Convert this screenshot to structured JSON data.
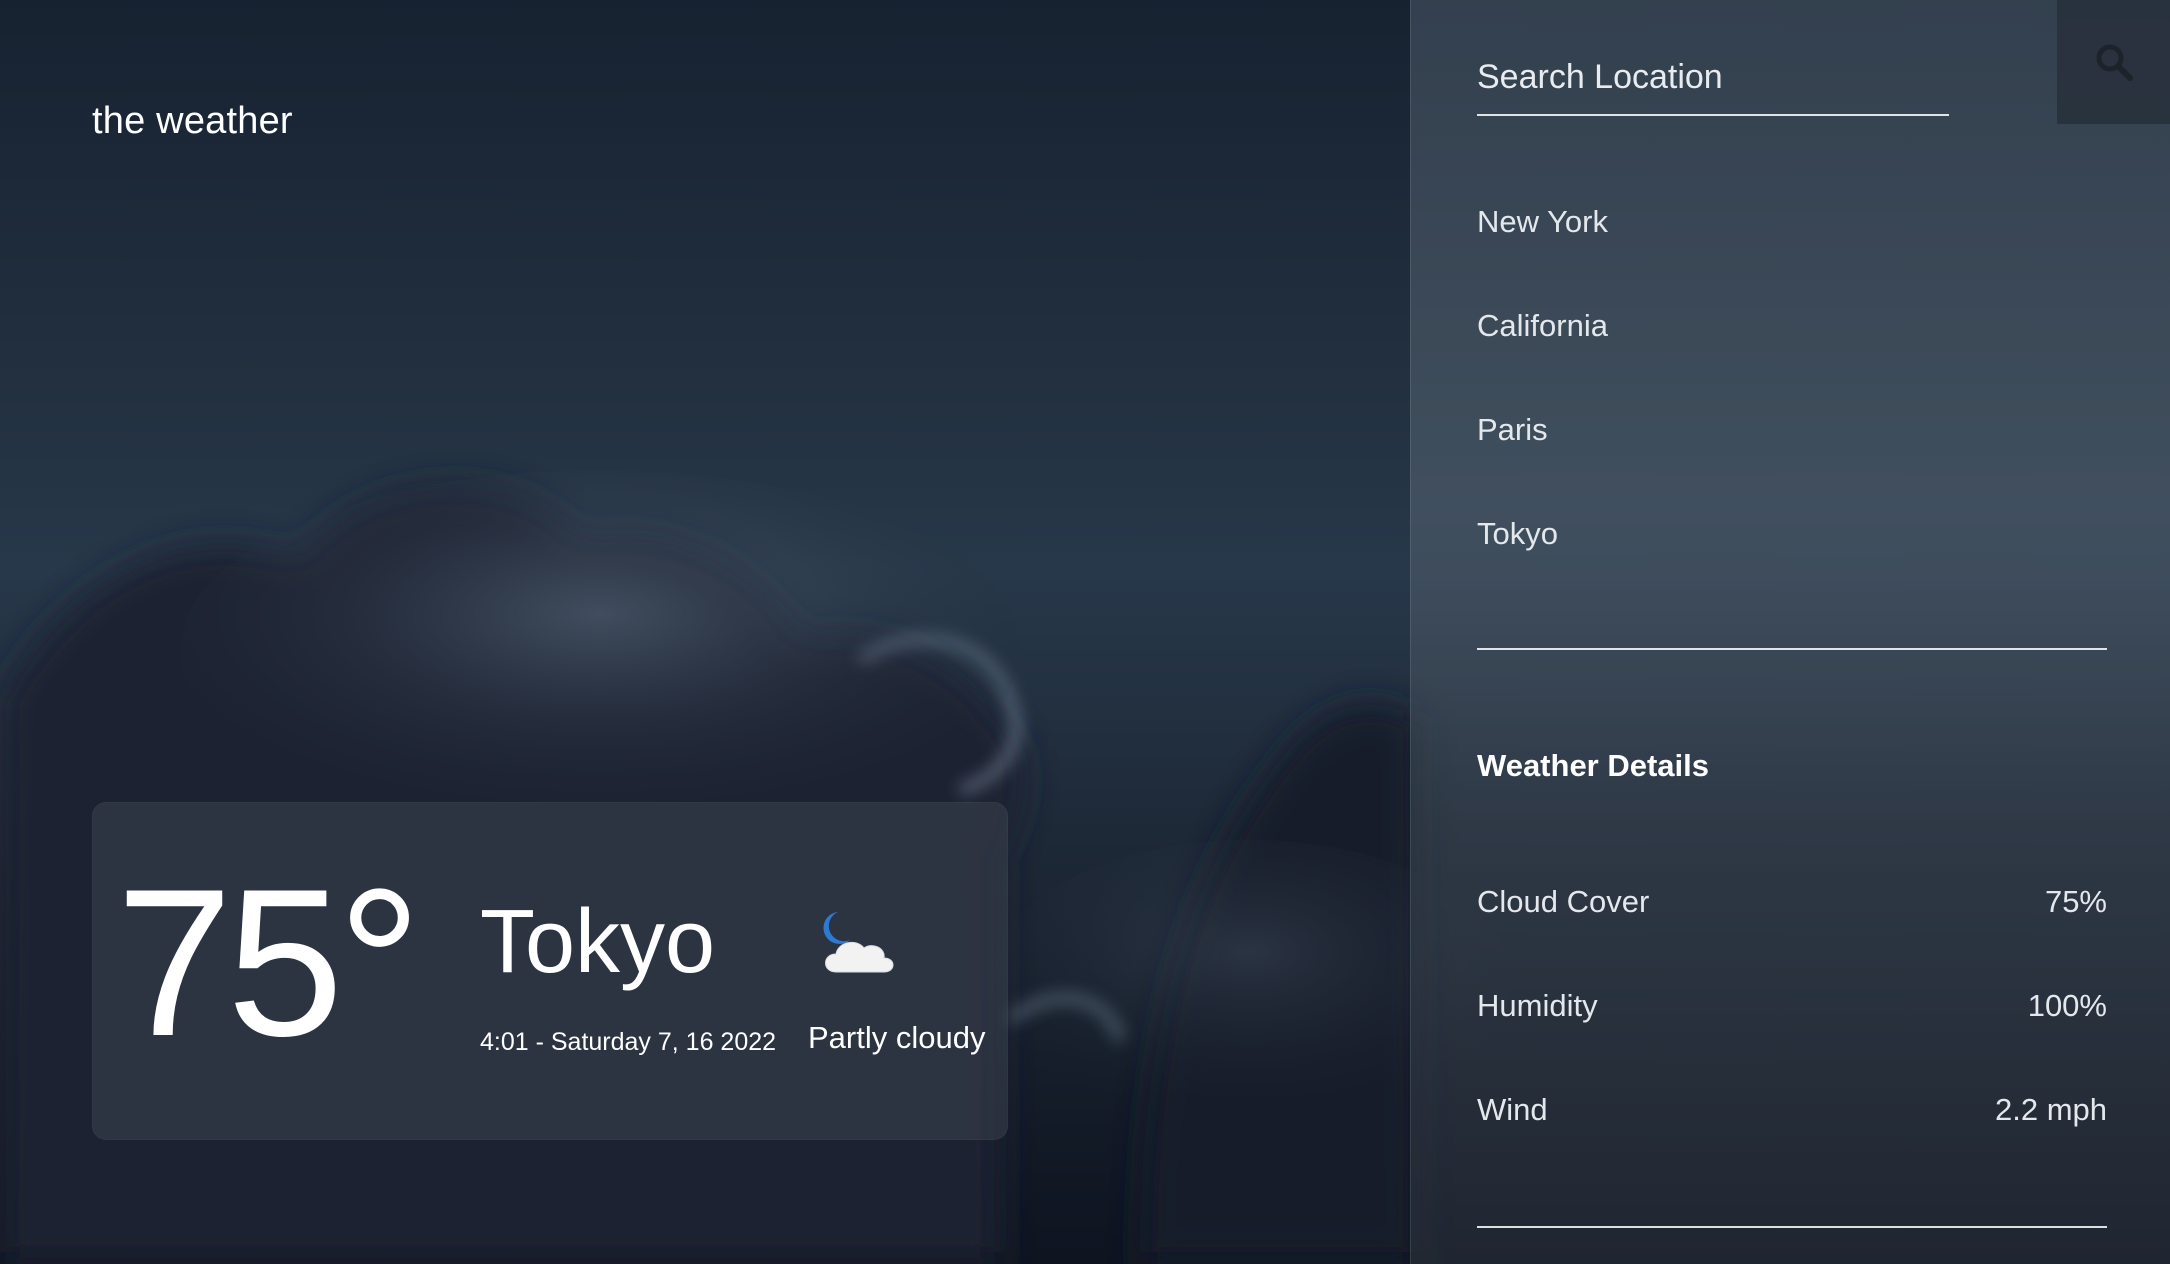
{
  "app": {
    "brand": "the weather"
  },
  "current": {
    "temperature": "75°",
    "city": "Tokyo",
    "datetime": "4:01 - Saturday 7, 16 2022",
    "condition": "Partly cloudy",
    "condition_icon": "partly-cloudy-night-icon"
  },
  "search": {
    "placeholder": "Search Location",
    "icon": "search-icon"
  },
  "locations": [
    "New York",
    "California",
    "Paris",
    "Tokyo"
  ],
  "details": {
    "title": "Weather Details",
    "rows": [
      {
        "label": "Cloud Cover",
        "value": "75%"
      },
      {
        "label": "Humidity",
        "value": "100%"
      },
      {
        "label": "Wind",
        "value": "2.2 mph"
      }
    ]
  },
  "colors": {
    "text": "#ffffff",
    "moon": "#2e7ad1",
    "cloud": "#f2f2f2"
  }
}
